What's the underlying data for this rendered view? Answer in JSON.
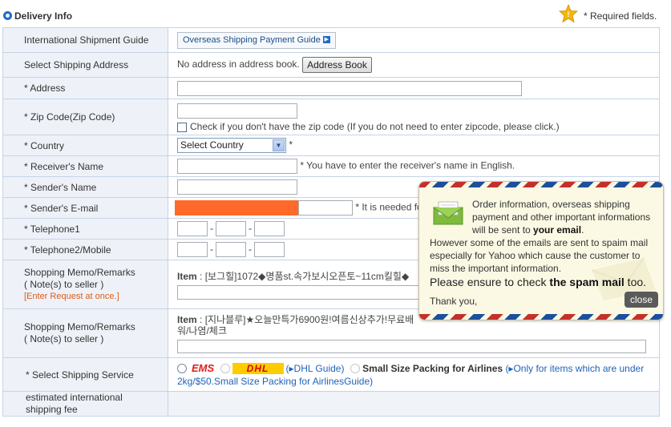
{
  "header": {
    "title": "Delivery Info",
    "required_note": "* Required fields."
  },
  "rows": {
    "guide": {
      "label": "International Shipment Guide",
      "button": "Overseas Shipping Payment Guide"
    },
    "address_select": {
      "label": "Select Shipping Address",
      "text": "No address in address book.",
      "button": "Address Book"
    },
    "address": {
      "label": "* Address",
      "value": ""
    },
    "zip": {
      "label": "* Zip Code(Zip Code)",
      "value": "",
      "checkbox_label": "Check if you don't have the zip code (If you do not need to enter zipcode, please click.)"
    },
    "country": {
      "label": "* Country",
      "selected": "Select Country",
      "required_mark": "*"
    },
    "receiver": {
      "label": "* Receiver's Name",
      "value": "",
      "note": "* You have to enter the receiver's name in English."
    },
    "sender": {
      "label": "* Sender's Name",
      "value": ""
    },
    "sender_email": {
      "label": "* Sender's E-mail",
      "note": "* It is needed fo"
    },
    "tel1": {
      "label": "* Telephone1",
      "dash": "-"
    },
    "tel2": {
      "label": "* Telephone2/Mobile",
      "dash": "-"
    },
    "memo1": {
      "label1": "Shopping Memo/Remarks",
      "label2": "( Note(s) to seller )",
      "label3": "[Enter Request at once.]",
      "item_prefix": "Item",
      "item_text": " : [보그힐]1072◆명품st.속가보시오픈토~11cm킬힐◆"
    },
    "memo2": {
      "label1": "Shopping Memo/Remarks",
      "label2": "( Note(s) to seller )",
      "item_prefix": "Item",
      "item_text": " : [지나블루]★오늘만특가6900원!여름신상추가!무료배",
      "item_text2": "워/나염/체크"
    },
    "shipping": {
      "label": "* Select Shipping Service",
      "ems": "EMS",
      "dhl": "DHL",
      "dhl_guide": "(▸DHL Guide)",
      "small": "Small Size Packing for Airlines",
      "small_note": "(▸Only for items which are unde",
      "small_note2": "r 2kg/$50.Small Size Packing for AirlinesGuide)"
    },
    "fee": {
      "label1": "estimated international",
      "label2": "shipping fee"
    }
  },
  "popup": {
    "line1": "Order information, overseas shipping",
    "line2": "payment and other important informations",
    "line3_pre": "will be sent to ",
    "line3_bold": "your email",
    "line3_post": ".",
    "para2": "However some of the emails are sent to spaim mail especially for Yahoo which cause the customer to miss the important information.",
    "ensure_pre": "Please ensure to check ",
    "ensure_bold": "the spam mail",
    "ensure_post": " too.",
    "thanks": "Thank you,",
    "close": "close"
  },
  "colors": {
    "accent": "#1e6bc9",
    "label_bg": "#eef2f8",
    "border": "#c5d3e6",
    "required_note": "#e05a17",
    "redaction": "#ff6a2a"
  }
}
